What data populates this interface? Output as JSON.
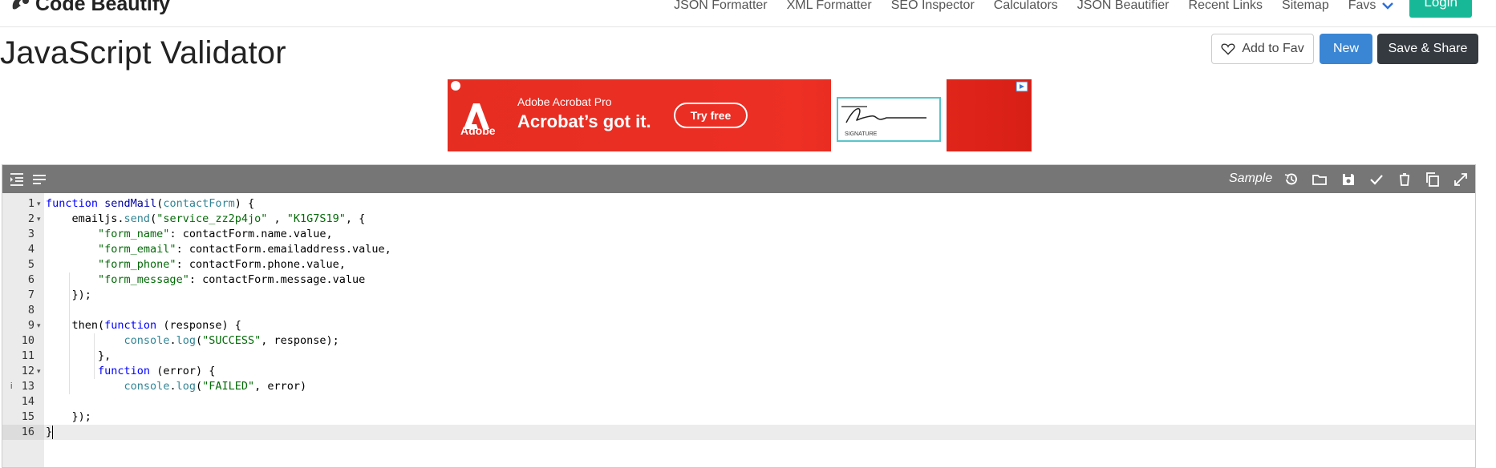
{
  "brand": {
    "name": "Code Beautify"
  },
  "nav": {
    "items": [
      "JSON Formatter",
      "XML Formatter",
      "SEO Inspector",
      "Calculators",
      "JSON Beautifier",
      "Recent Links",
      "Sitemap"
    ],
    "favs_label": "Favs",
    "login_label": "Login"
  },
  "page": {
    "title": "JavaScript Validator"
  },
  "actions": {
    "fav_label": "Add to Fav",
    "new_label": "New",
    "save_label": "Save & Share"
  },
  "ad": {
    "brand_word": "Adobe",
    "subtitle": "Adobe Acrobat Pro",
    "headline": "Acrobat’s got it.",
    "cta": "Try free",
    "signature_label": "SIGNATURE"
  },
  "editor": {
    "toolbar": {
      "sample_label": "Sample",
      "icons": [
        "indent-icon",
        "wrap-lines-icon",
        "history-icon",
        "open-folder-icon",
        "save-icon",
        "check-icon",
        "delete-icon",
        "copy-icon",
        "fullscreen-icon"
      ]
    },
    "lines": [
      {
        "n": "1",
        "fold": true,
        "text": "function sendMail(contactForm) {"
      },
      {
        "n": "2",
        "fold": true,
        "text": "    emailjs.send(\"service_zz2p4jo\" , \"K1G7S19\", {"
      },
      {
        "n": "3",
        "fold": false,
        "text": "        \"form_name\": contactForm.name.value,"
      },
      {
        "n": "4",
        "fold": false,
        "text": "        \"form_email\": contactForm.emailaddress.value,"
      },
      {
        "n": "5",
        "fold": false,
        "text": "        \"form_phone\": contactForm.phone.value,"
      },
      {
        "n": "6",
        "fold": false,
        "text": "        \"form_message\": contactForm.message.value"
      },
      {
        "n": "7",
        "fold": false,
        "text": "    });"
      },
      {
        "n": "8",
        "fold": false,
        "text": ""
      },
      {
        "n": "9",
        "fold": true,
        "text": "    then(function (response) {"
      },
      {
        "n": "10",
        "fold": false,
        "text": "            console.log(\"SUCCESS\", response);"
      },
      {
        "n": "11",
        "fold": false,
        "text": "        },"
      },
      {
        "n": "12",
        "fold": true,
        "text": "        function (error) {"
      },
      {
        "n": "13",
        "fold": false,
        "warn": true,
        "text": "            console.log(\"FAILED\", error)"
      },
      {
        "n": "14",
        "fold": false,
        "text": ""
      },
      {
        "n": "15",
        "fold": false,
        "text": "    });"
      },
      {
        "n": "16",
        "fold": false,
        "active": true,
        "text": "}"
      }
    ],
    "colors": {
      "keyword": "#0000ff",
      "string": "#036a07",
      "param": "#318495",
      "toolbar": "#767676"
    }
  }
}
